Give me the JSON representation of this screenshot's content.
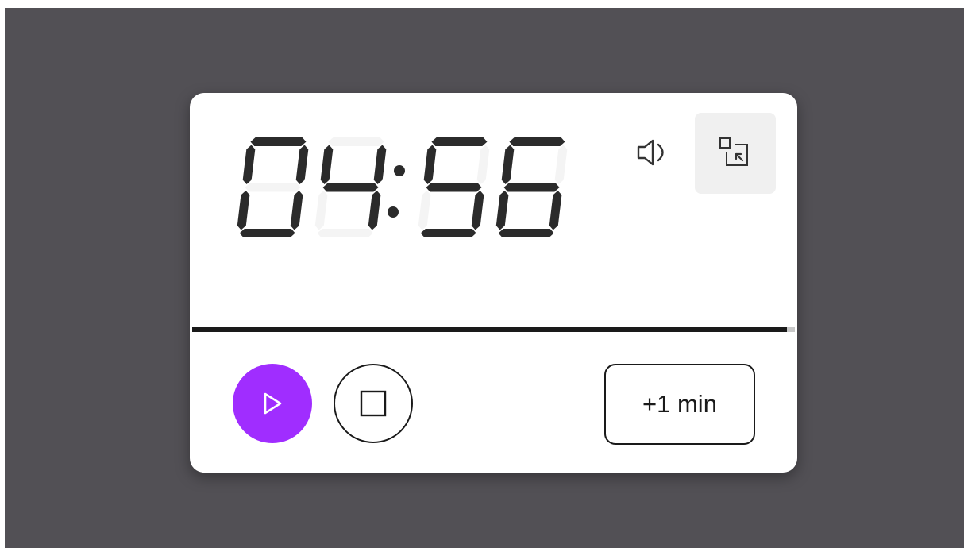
{
  "timer": {
    "time": "04:56",
    "digits": [
      "0",
      "4",
      "5",
      "6"
    ]
  },
  "progress": {
    "fraction": 0.987
  },
  "controls": {
    "add_minute_label": "+1 min",
    "play_icon": "play-icon",
    "stop_icon": "stop-icon",
    "sound_icon": "speaker-icon",
    "mini_mode_icon": "minimize-window-icon"
  },
  "colors": {
    "backdrop": "#525055",
    "play_button": "#a02dff",
    "digit_on": "#2b2b2b",
    "digit_off": "#f4f4f4",
    "progress_fill": "#1a1a1a",
    "progress_track": "#c8c8c8"
  }
}
